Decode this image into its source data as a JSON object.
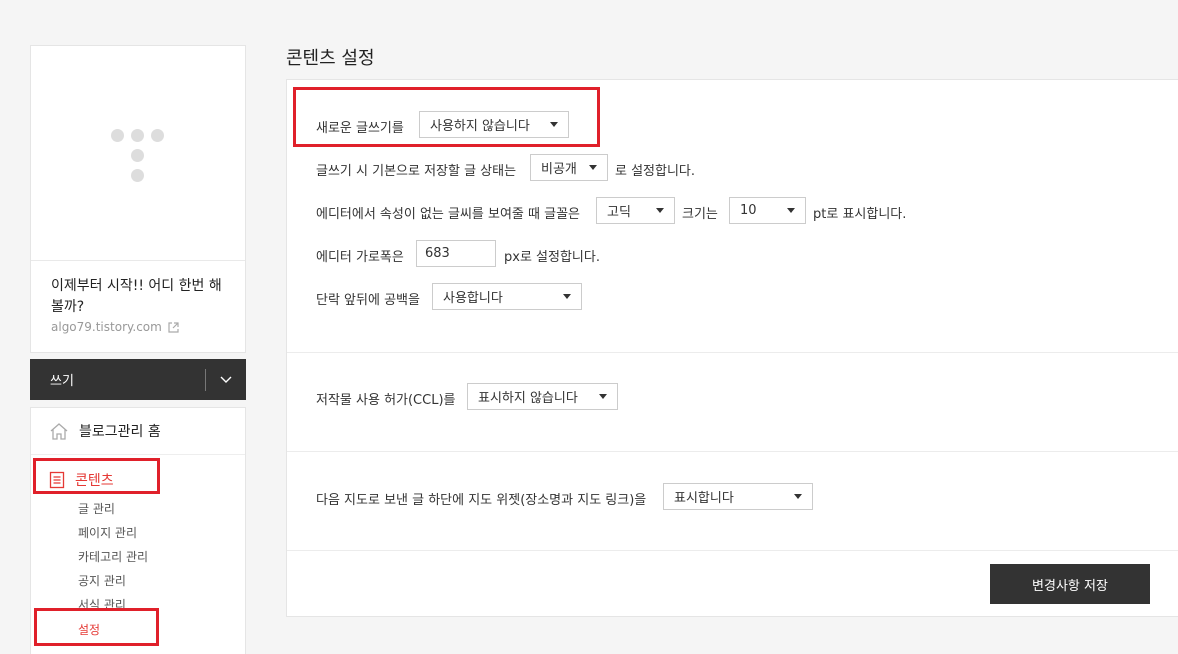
{
  "sidebar": {
    "blog_title": "이제부터 시작!! 어디 한번 해볼까?",
    "blog_url": "algo79.tistory.com",
    "write_label": "쓰기",
    "home_label": "블로그관리 홈",
    "content_label": "콘텐츠",
    "sub_items": [
      "글 관리",
      "페이지 관리",
      "카테고리 관리",
      "공지 관리",
      "서식 관리"
    ],
    "settings_label": "설정"
  },
  "main": {
    "title": "콘텐츠 설정",
    "new_editor_label": "새로운 글쓰기를",
    "new_editor_value": "사용하지 않습니다",
    "default_status_prefix": "글쓰기 시 기본으로 저장할 글 상태는",
    "default_status_value": "비공개",
    "default_status_suffix": "로 설정합니다.",
    "font_prefix": "에디터에서 속성이 없는 글씨를 보여줄 때 글꼴은",
    "font_value": "고딕",
    "font_size_label": "크기는",
    "font_size_value": "10",
    "font_suffix": "pt로 표시합니다.",
    "width_prefix": "에디터 가로폭은",
    "width_value": "683",
    "width_suffix": "px로 설정합니다.",
    "spacing_label": "단락 앞뒤에 공백을",
    "spacing_value": "사용합니다",
    "ccl_label": "저작물 사용 허가(CCL)를",
    "ccl_value": "표시하지 않습니다",
    "map_label": "다음 지도로 보낸 글 하단에 지도 위젯(장소명과 지도 링크)을",
    "map_value": "표시합니다",
    "save_label": "변경사항 저장"
  },
  "colors": {
    "accent": "#e53935",
    "highlight_box": "#e0202a",
    "dark_button": "#333333"
  }
}
